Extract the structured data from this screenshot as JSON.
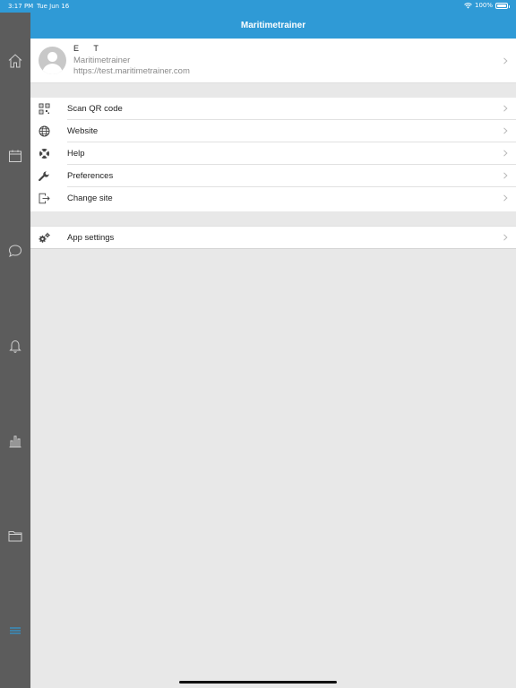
{
  "status_bar": {
    "time": "3:17 PM",
    "date": "Tue Jun 16",
    "battery": "100%"
  },
  "header": {
    "title": "Maritimetrainer"
  },
  "profile": {
    "name": "E T",
    "site_name": "Maritimetrainer",
    "site_url": "https://test.maritimetrainer.com"
  },
  "menu": {
    "items": [
      {
        "label": "Scan QR code",
        "icon": "qr-code-icon"
      },
      {
        "label": "Website",
        "icon": "globe-icon"
      },
      {
        "label": "Help",
        "icon": "life-ring-icon"
      },
      {
        "label": "Preferences",
        "icon": "wrench-icon"
      },
      {
        "label": "Change site",
        "icon": "sign-out-icon"
      }
    ]
  },
  "settings": {
    "label": "App settings",
    "icon": "cogs-icon"
  },
  "sidebar": {
    "items": [
      "home-icon",
      "calendar-icon",
      "chat-icon",
      "bell-icon",
      "bar-chart-icon",
      "folder-icon",
      "menu-icon"
    ],
    "active": "menu-icon"
  },
  "colors": {
    "accent": "#2f9ad6",
    "sidebar": "#5c5c5c",
    "background": "#e8e8e8"
  }
}
